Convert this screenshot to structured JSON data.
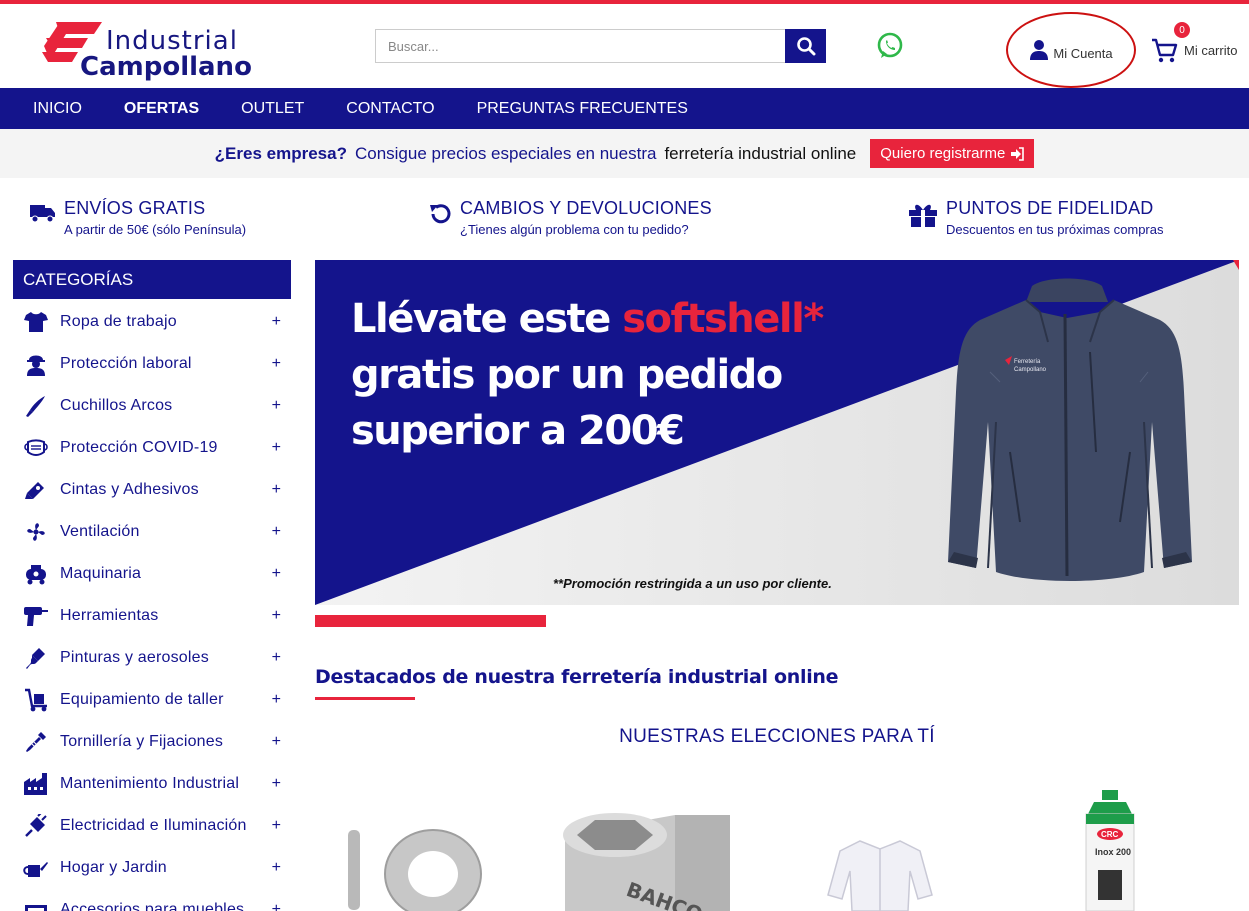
{
  "brand": {
    "name_line1": "Industrial",
    "name_line2": "Campollano",
    "colors": {
      "primary": "#14148c",
      "accent": "#e8243c"
    }
  },
  "header": {
    "search_placeholder": "Buscar...",
    "search_icon": "search-icon",
    "whatsapp_icon": "whatsapp-icon",
    "account_label": "Mi Cuenta",
    "cart_label": "Mi carrito",
    "cart_count": "0"
  },
  "nav": {
    "items": [
      {
        "label": "INICIO"
      },
      {
        "label": "OFERTAS"
      },
      {
        "label": "OUTLET"
      },
      {
        "label": "CONTACTO"
      },
      {
        "label": "PREGUNTAS FRECUENTES"
      }
    ]
  },
  "promo": {
    "question": "¿Eres empresa?",
    "text": "Consigue precios especiales en nuestra",
    "highlight": "ferretería industrial online",
    "button": "Quiero registrarme"
  },
  "features": [
    {
      "title": "ENVÍOS GRATIS",
      "subtitle": "A partir de 50€ (sólo Península)",
      "icon": "truck-icon"
    },
    {
      "title": "CAMBIOS Y DEVOLUCIONES",
      "subtitle": "¿Tienes algún problema con tu pedido?",
      "icon": "undo-icon"
    },
    {
      "title": "PUNTOS DE FIDELIDAD",
      "subtitle": "Descuentos en tus próximas compras",
      "icon": "gift-icon"
    }
  ],
  "sidebar": {
    "title": "CATEGORÍAS",
    "items": [
      {
        "label": "Ropa de trabajo",
        "icon": "shirt-icon"
      },
      {
        "label": "Protección laboral",
        "icon": "worker-icon"
      },
      {
        "label": "Cuchillos Arcos",
        "icon": "knife-icon"
      },
      {
        "label": "Protección COVID-19",
        "icon": "mask-icon"
      },
      {
        "label": "Cintas y Adhesivos",
        "icon": "tape-icon"
      },
      {
        "label": "Ventilación",
        "icon": "fan-icon"
      },
      {
        "label": "Maquinaria",
        "icon": "machine-icon"
      },
      {
        "label": "Herramientas",
        "icon": "drill-icon"
      },
      {
        "label": "Pinturas y aerosoles",
        "icon": "brush-icon"
      },
      {
        "label": "Equipamiento de taller",
        "icon": "trolley-icon"
      },
      {
        "label": "Tornillería y Fijaciones",
        "icon": "screw-icon"
      },
      {
        "label": "Mantenimiento Industrial",
        "icon": "factory-icon"
      },
      {
        "label": "Electricidad e Iluminación",
        "icon": "plug-icon"
      },
      {
        "label": "Hogar y Jardin",
        "icon": "watering-can-icon"
      },
      {
        "label": "Accesorios para muebles",
        "icon": "furniture-icon"
      }
    ],
    "expand_symbol": "+"
  },
  "banner": {
    "line1_a": "Llévate este ",
    "line1_b": "softshell*",
    "line2": "gratis por un pedido",
    "line3": "superior a 200€",
    "note": "**Promoción restringida a un uso por cliente.",
    "jacket_brand_1": "Ferretería",
    "jacket_brand_2": "Campollano"
  },
  "featured": {
    "title": "Destacados de nuestra ferretería industrial online",
    "subtitle": "NUESTRAS ELECCIONES PARA TÍ"
  },
  "products": [
    {
      "label": "",
      "icon": "washer-icon"
    },
    {
      "label": "BAHCO",
      "icon": "socket-icon"
    },
    {
      "label": "",
      "icon": "white-coat-icon"
    },
    {
      "label": "CRC",
      "sub": "Inox 200",
      "icon": "spray-can-icon"
    }
  ]
}
